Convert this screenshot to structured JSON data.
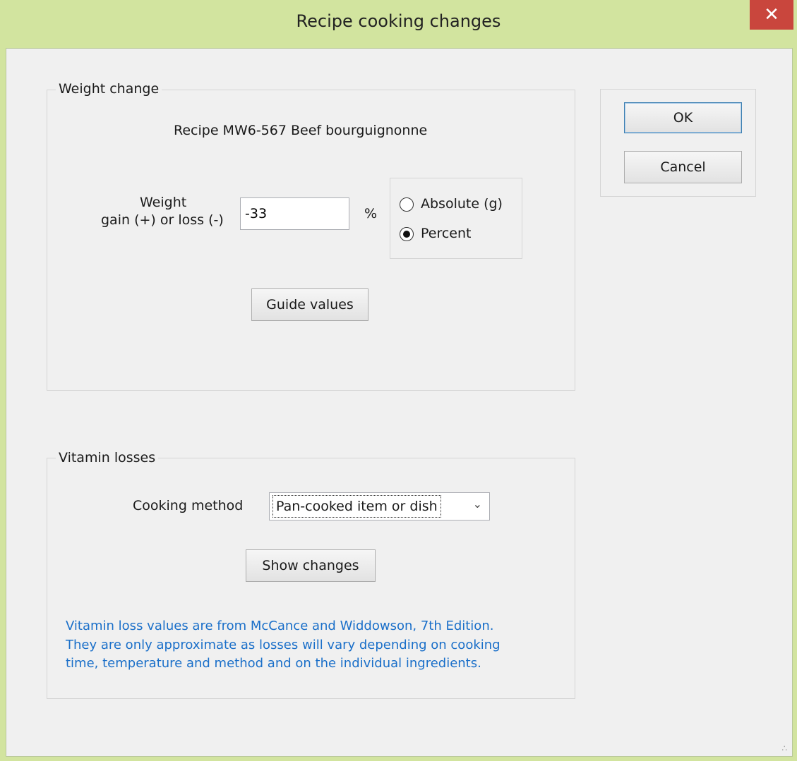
{
  "window": {
    "title": "Recipe cooking changes",
    "close_glyph": "✕"
  },
  "weight_group": {
    "legend": "Weight change",
    "recipe_label": "Recipe MW6-567 Beef bourguignonne",
    "weight_label_line1": "Weight",
    "weight_label_line2": "gain (+) or loss (-)",
    "weight_value": "-33",
    "unit": "%",
    "radio_absolute": "Absolute (g)",
    "radio_percent": "Percent",
    "selected_mode": "Percent",
    "guide_button": "Guide values"
  },
  "buttons": {
    "ok": "OK",
    "cancel": "Cancel"
  },
  "vitamin_group": {
    "legend": "Vitamin losses",
    "method_label": "Cooking method",
    "method_value": "Pan-cooked item or dish",
    "show_button": "Show changes",
    "note_line1": "Vitamin loss values are from McCance and Widdowson, 7th Edition.",
    "note_line2": "They are only approximate as losses will vary depending on cooking",
    "note_line3": "time, temperature and method and on the individual ingredients."
  },
  "colors": {
    "frame": "#d2e49f",
    "close": "#c9463d",
    "note": "#1a6fc9"
  },
  "icons": {
    "close": "close-icon",
    "dropdown": "chevron-down-icon",
    "resize": "resize-grip-icon"
  }
}
